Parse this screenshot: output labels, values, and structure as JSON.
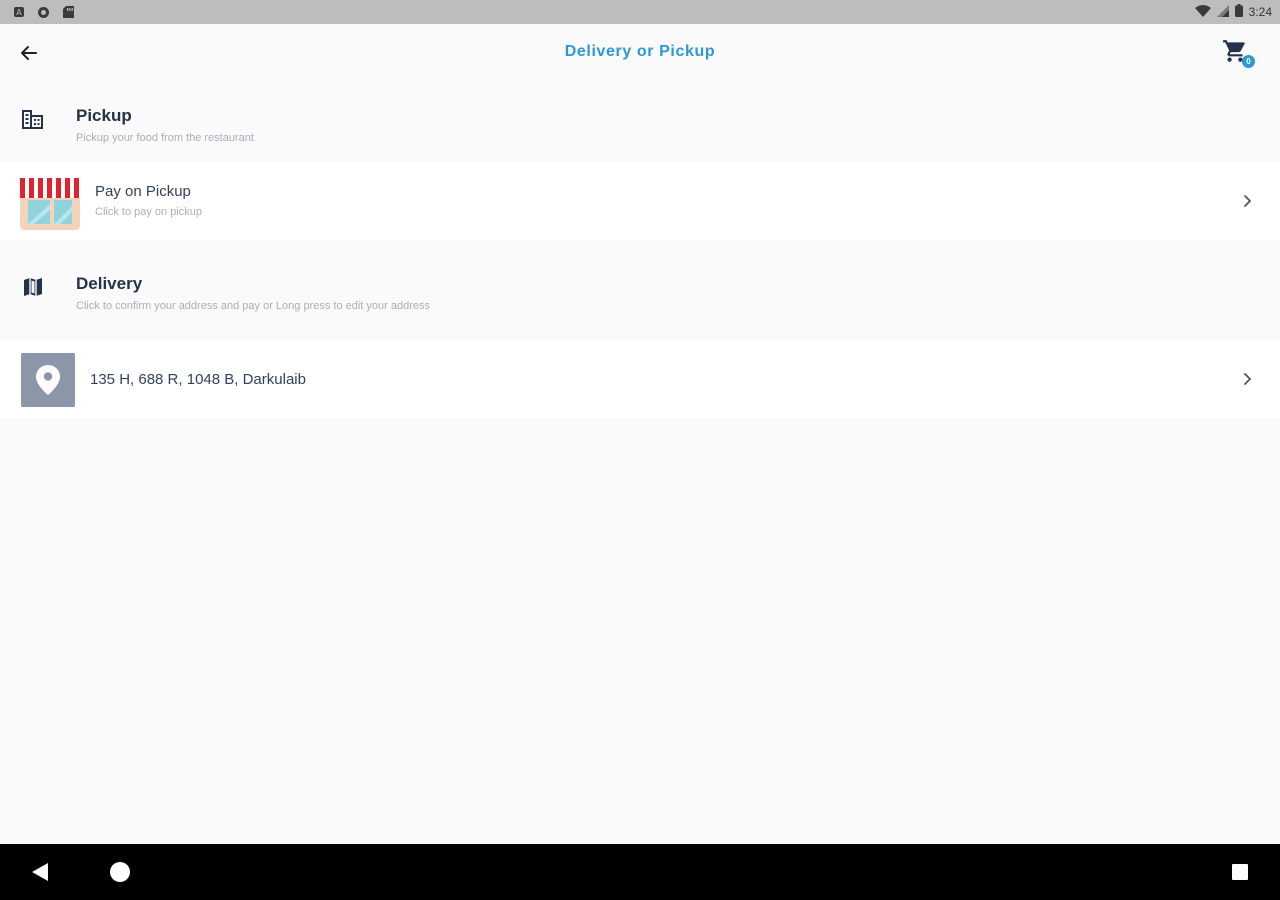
{
  "status_bar": {
    "time": "3:24",
    "left_icons": [
      "notification-a-icon",
      "sync-icon",
      "sd-card-icon"
    ],
    "right_icons": [
      "wifi-icon",
      "signal-icon",
      "battery-icon"
    ]
  },
  "app_bar": {
    "title": "Delivery or Pickup",
    "cart_count": "0",
    "accent_color": "#2c98d6"
  },
  "pickup": {
    "title": "Pickup",
    "subtitle": "Pickup your food from the restaurant",
    "icon": "building-icon",
    "option": {
      "title": "Pay on Pickup",
      "subtitle": "Click to pay on pickup",
      "icon": "store-icon"
    }
  },
  "delivery": {
    "title": "Delivery",
    "subtitle": "Click to confirm your address and pay or Long press to edit your address",
    "icon": "map-icon",
    "address": {
      "text": "135 H, 688 R, 1048 B, Darkulaib",
      "icon": "location-pin-icon"
    }
  },
  "nav_bar": {
    "buttons": [
      "back-icon",
      "home-icon",
      "recents-icon"
    ]
  }
}
